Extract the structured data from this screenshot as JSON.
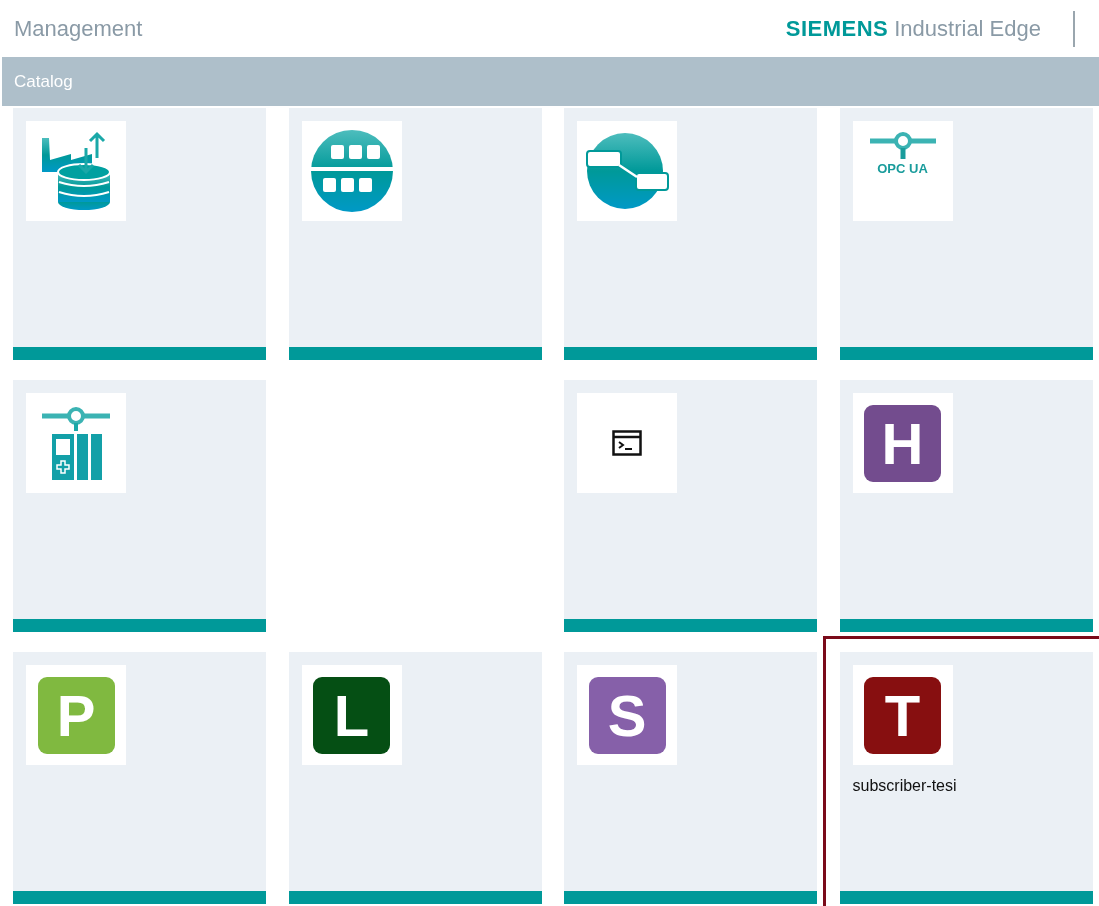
{
  "header": {
    "title": "Management",
    "brand": "SIEMENS",
    "product": "Industrial Edge"
  },
  "catalog": {
    "title": "Catalog"
  },
  "apps": [
    {
      "kind": "factory-data",
      "selected": false
    },
    {
      "kind": "network",
      "selected": false
    },
    {
      "kind": "flow",
      "selected": false
    },
    {
      "kind": "opcua",
      "badge": "OPC UA",
      "selected": false
    },
    {
      "kind": "device",
      "selected": false
    },
    {
      "kind": "empty"
    },
    {
      "kind": "terminal",
      "selected": false
    },
    {
      "kind": "letter",
      "letter": "H",
      "color": "#734c8e",
      "selected": false
    },
    {
      "kind": "letter",
      "letter": "P",
      "color": "#80b940",
      "selected": false
    },
    {
      "kind": "letter",
      "letter": "L",
      "color": "#054f14",
      "selected": false
    },
    {
      "kind": "letter",
      "letter": "S",
      "color": "#8660a9",
      "selected": false
    },
    {
      "kind": "letter",
      "letter": "T",
      "color": "#870f10",
      "label": "subscriber-tesi",
      "selected": true
    }
  ]
}
